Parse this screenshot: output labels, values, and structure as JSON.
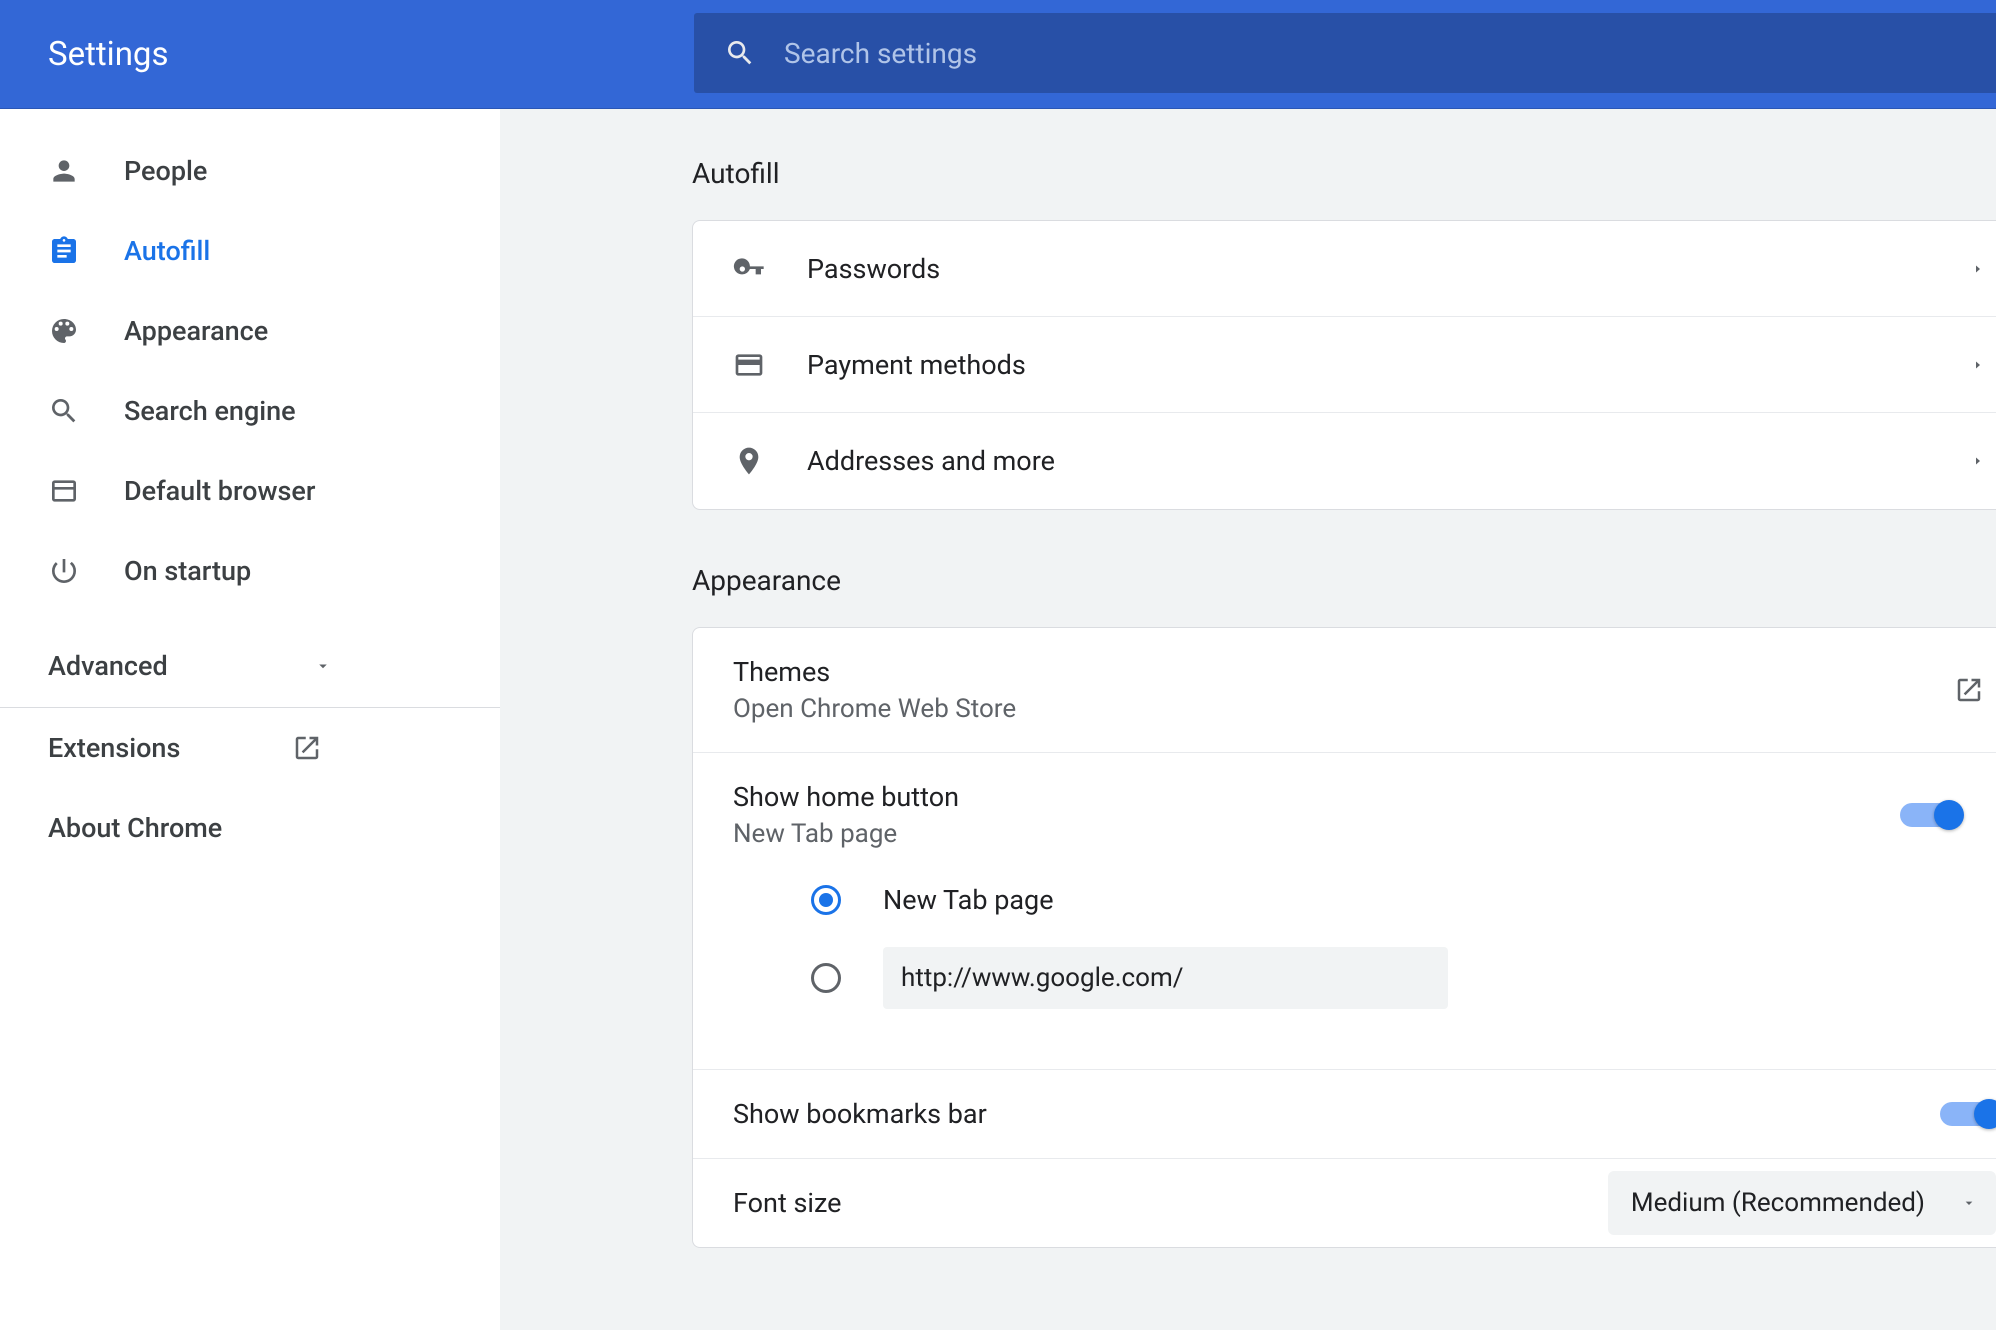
{
  "header": {
    "title": "Settings",
    "search_placeholder": "Search settings"
  },
  "sidebar": {
    "items": [
      {
        "label": "People",
        "icon": "person-icon",
        "active": false
      },
      {
        "label": "Autofill",
        "icon": "assignment-icon",
        "active": true
      },
      {
        "label": "Appearance",
        "icon": "palette-icon",
        "active": false
      },
      {
        "label": "Search engine",
        "icon": "search-icon",
        "active": false
      },
      {
        "label": "Default browser",
        "icon": "browser-icon",
        "active": false
      },
      {
        "label": "On startup",
        "icon": "power-icon",
        "active": false
      }
    ],
    "advanced_label": "Advanced",
    "extensions_label": "Extensions",
    "about_label": "About Chrome"
  },
  "sections": {
    "autofill": {
      "title": "Autofill",
      "rows": [
        {
          "label": "Passwords",
          "icon": "key-icon"
        },
        {
          "label": "Payment methods",
          "icon": "credit-card-icon"
        },
        {
          "label": "Addresses and more",
          "icon": "location-icon"
        }
      ]
    },
    "appearance": {
      "title": "Appearance",
      "themes": {
        "primary": "Themes",
        "secondary": "Open Chrome Web Store"
      },
      "home_button": {
        "primary": "Show home button",
        "secondary": "New Tab page",
        "toggle_on": true,
        "radio_new_tab": "New Tab page",
        "radio_custom_url_value": "http://www.google.com/"
      },
      "bookmarks_bar": {
        "primary": "Show bookmarks bar",
        "toggle_on": true
      },
      "font_size": {
        "primary": "Font size",
        "selected": "Medium (Recommended)"
      }
    }
  }
}
